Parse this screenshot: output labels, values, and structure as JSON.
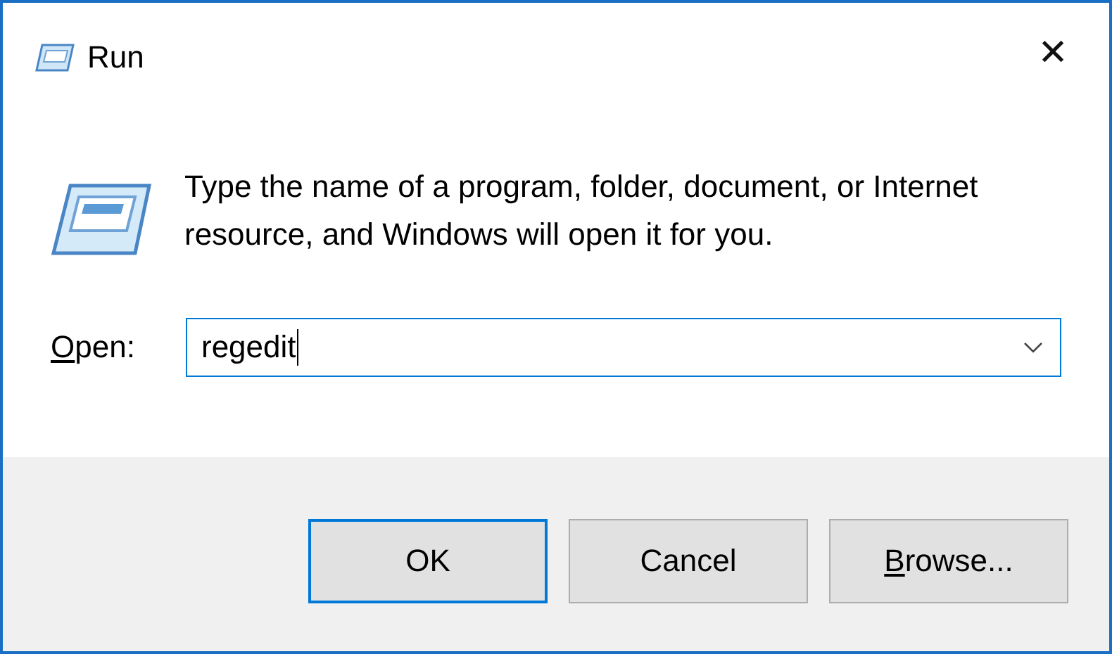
{
  "window": {
    "title": "Run",
    "close": "✕"
  },
  "message": "Type the name of a program, folder, document, or Internet resource, and Windows will open it for you.",
  "open_field": {
    "label": "Open:",
    "first_letter_underlined": true,
    "value": "regedit",
    "focused": true
  },
  "buttons": [
    {
      "label": "OK",
      "default": true,
      "first_letter_underlined": false
    },
    {
      "label": "Cancel",
      "default": false,
      "first_letter_underlined": false
    },
    {
      "label": "Browse...",
      "default": false,
      "first_letter_underlined": true
    }
  ]
}
